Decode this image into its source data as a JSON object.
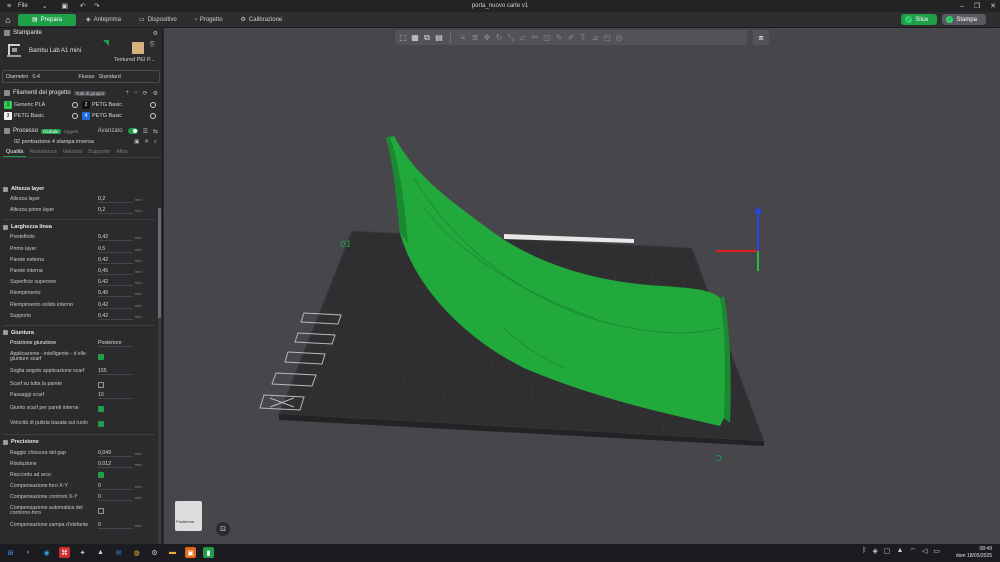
{
  "window": {
    "title": "porta_nuovo carte v1",
    "menu_label": "File"
  },
  "tabs": {
    "prepare": "Prepara",
    "preview": "Anteprima",
    "device": "Dispositivo",
    "project": "Progetto",
    "calibration": "Calibrazione",
    "slice": "Slice",
    "print": "Stampa"
  },
  "printer": {
    "section_title": "Stampante",
    "name": "Bambu Lab A1 mini",
    "plate": "Textured PEI P...",
    "diameter_label": "Diametro",
    "diameter_value": "0.4",
    "flow_label": "Flusso",
    "flow_value": "Standard"
  },
  "filaments": {
    "section_title": "Filamenti del progetto",
    "badge": "Tutti di gruppo",
    "items": [
      {
        "num": "1",
        "name": "Generic PLA",
        "color": "#2ecc56"
      },
      {
        "num": "2",
        "name": "PETG Basic",
        "color": "#111111"
      },
      {
        "num": "3",
        "name": "PETG Basic",
        "color": "#f2f2f2"
      },
      {
        "num": "4",
        "name": "PETG Basic",
        "color": "#1e6fd9"
      }
    ]
  },
  "process": {
    "section_title": "Processo",
    "global_label": "Globale",
    "objects_label": "Oggetti",
    "advanced_label": "Avanzato",
    "preset": "02 pentrazione 4 stampa inversa",
    "subtabs": [
      "Qualità",
      "Resistenza",
      "Velocità",
      "Supporto",
      "Altro"
    ]
  },
  "settings": {
    "layer_height": {
      "title": "Altezza layer",
      "rows": [
        {
          "label": "Altezza layer",
          "value": "0,2",
          "unit": "mm"
        },
        {
          "label": "Altezza primo layer",
          "value": "0,2",
          "unit": "mm"
        }
      ]
    },
    "line_width": {
      "title": "Larghezza linea",
      "rows": [
        {
          "label": "Predefinito",
          "value": "0,42",
          "unit": "mm"
        },
        {
          "label": "Primo layer",
          "value": "0,5",
          "unit": "mm"
        },
        {
          "label": "Parete esterna",
          "value": "0,42",
          "unit": "mm"
        },
        {
          "label": "Parete interna",
          "value": "0,45",
          "unit": "mm"
        },
        {
          "label": "Superficie superiore",
          "value": "0,42",
          "unit": "mm"
        },
        {
          "label": "Riempimento",
          "value": "0,45",
          "unit": "mm"
        },
        {
          "label": "Riempimento solido interno",
          "value": "0,42",
          "unit": "mm"
        },
        {
          "label": "Supporto",
          "value": "0,42",
          "unit": "mm"
        }
      ]
    },
    "seam": {
      "title": "Giuntura",
      "position_label": "Posizione giunzione",
      "position_value": "Posteriore",
      "scarf_apply_label": "Applicazione - intelligente - d elle giunture scarf",
      "scarf_angle_label": "Soglia angolo applicazione scarf",
      "scarf_angle_value": "155",
      "scarf_entire_label": "Scarf su tutta la parete",
      "scarf_steps_label": "Passaggi scarf",
      "scarf_steps_value": "10",
      "scarf_inner_label": "Giunto scarf per pareti interne",
      "wipe_speed_label": "Velocità di pulizia basata sul ruolo"
    },
    "precision": {
      "title": "Precisione",
      "rows": [
        {
          "label": "Raggio chiusura del gap",
          "value": "0,049",
          "unit": "mm"
        },
        {
          "label": "Risoluzione",
          "value": "0,012",
          "unit": "mm"
        }
      ],
      "arc_label": "Raccordo ad arco",
      "xy_hole_label": "Compensazione foro X-Y",
      "xy_hole_value": "0",
      "xy_contour_label": "Compensazione contorni X-Y",
      "xy_contour_value": "0",
      "auto_comp_label": "Compensazione automatica del contorno-foro",
      "elephant_label": "Compensazione zampa d'elefante",
      "elephant_value": "0",
      "unit": "mm"
    }
  },
  "viewport": {
    "navcube_label": "Posteriore",
    "plate_number": "01"
  },
  "clock": {
    "time": "08:49",
    "date": "dom 18/05/2025"
  },
  "colors": {
    "accent": "#1f9f48",
    "model": "#22a93c",
    "plate": "#2e2e31"
  }
}
